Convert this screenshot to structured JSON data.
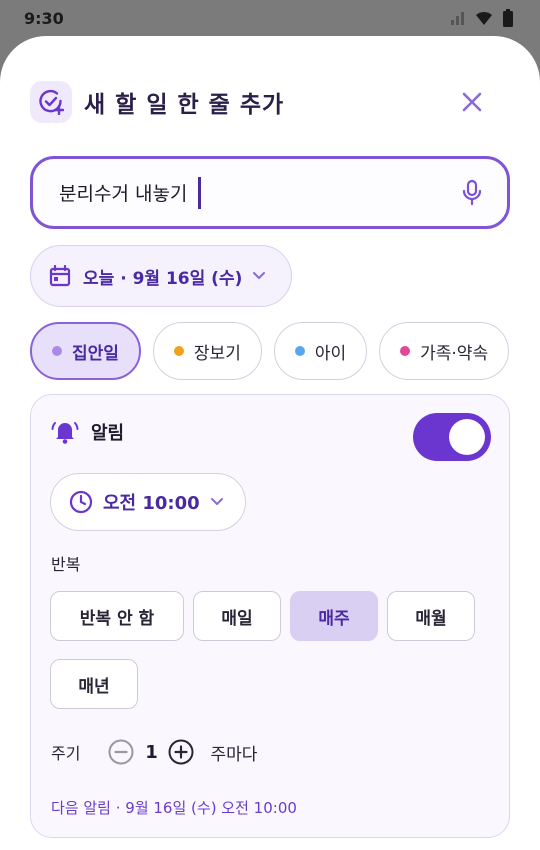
{
  "status": {
    "time": "9:30"
  },
  "header": {
    "title": "새 할 일 한 줄 추가"
  },
  "task_input": {
    "value": "분리수거 내놓기"
  },
  "date_chip": {
    "label": "오늘 · 9월 16일 (수)"
  },
  "categories": [
    {
      "label": "집안일",
      "color": "#a98ae6",
      "active": true
    },
    {
      "label": "장보기",
      "color": "#f0a21a",
      "active": false
    },
    {
      "label": "아이",
      "color": "#5aa6ee",
      "active": false
    },
    {
      "label": "가족·약속",
      "color": "#e0479a",
      "active": false
    }
  ],
  "alarm": {
    "label": "알림",
    "enabled": true,
    "time": "오전 10:00",
    "repeat_label": "반복",
    "repeat_options": [
      "반복 안 함",
      "매일",
      "매주",
      "매월",
      "매년"
    ],
    "repeat_selected": "매주",
    "cycle_label": "주기",
    "cycle_value": "1",
    "cycle_unit": "주마다",
    "next_alarm": "다음 알림 · 9월 16일 (수) 오전 10:00"
  },
  "colors": {
    "accent": "#6a36cf",
    "accent_text": "#4a2aa0",
    "selected_bg": "#d9cff3"
  }
}
